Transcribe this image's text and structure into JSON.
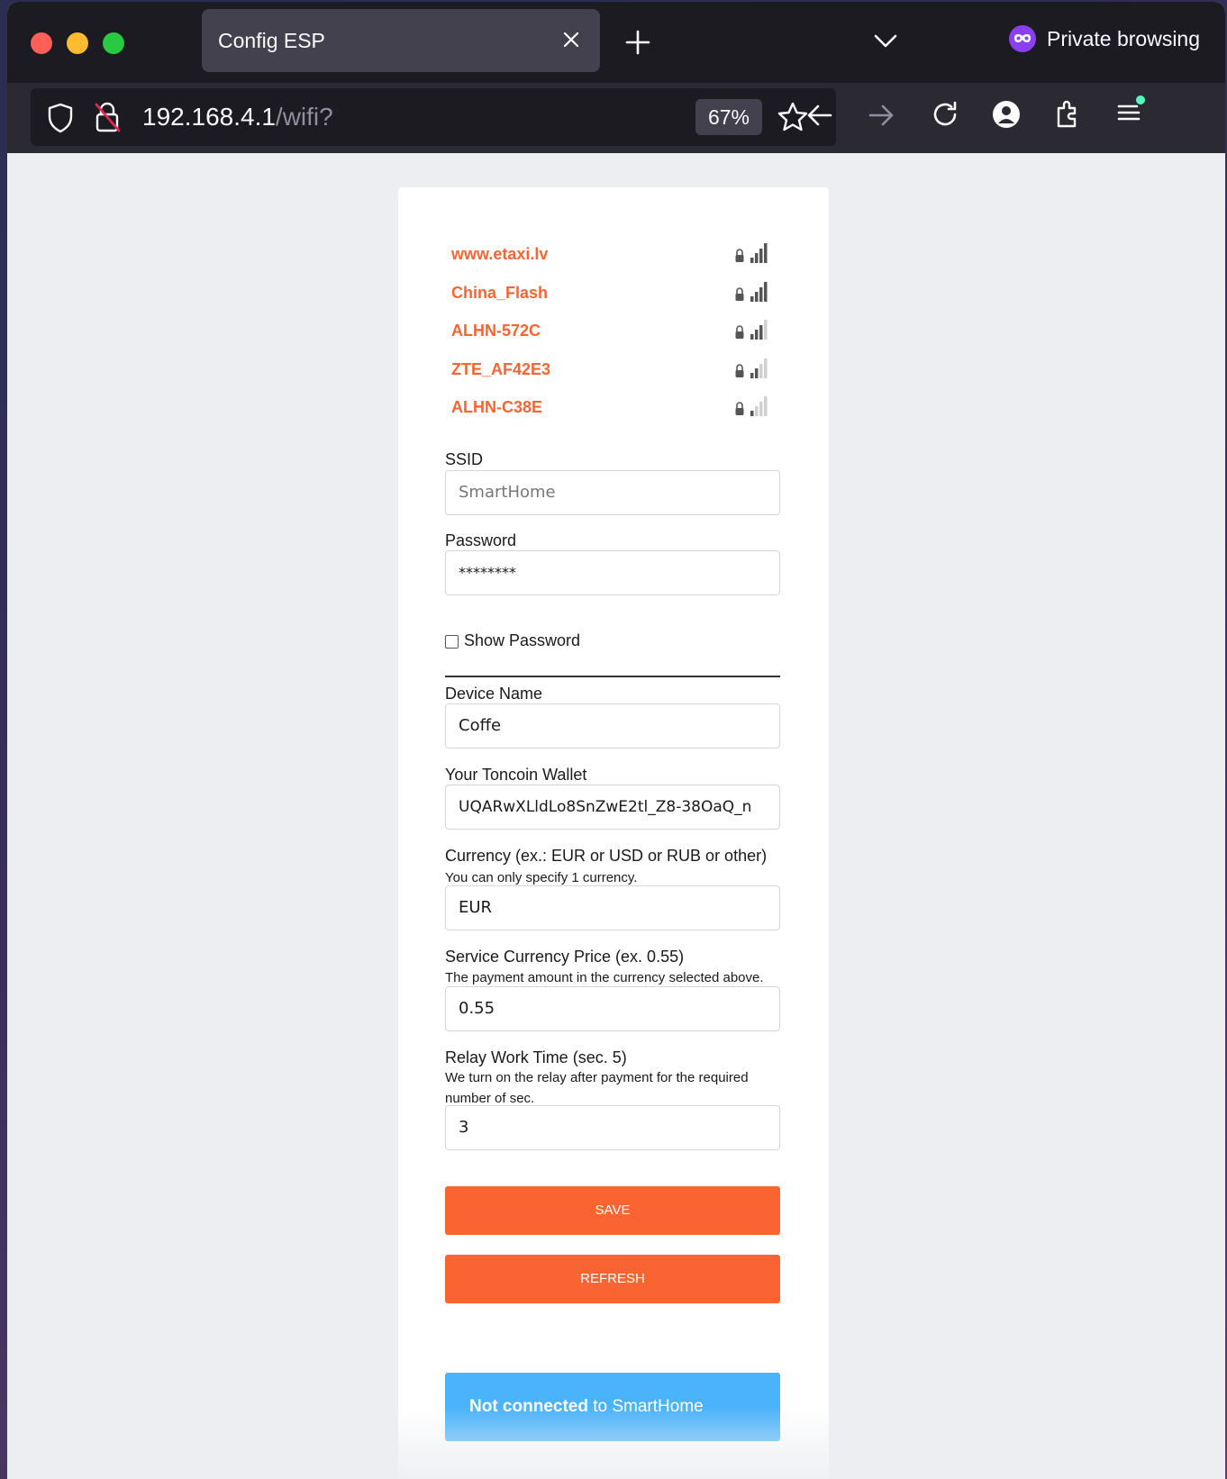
{
  "browser": {
    "tab_title": "Config ESP",
    "private_label": "Private browsing",
    "url_host": "192.168.4.1",
    "url_path": "/wifi?",
    "zoom": "67%"
  },
  "networks": [
    {
      "ssid": "www.etaxi.lv",
      "signal_bars": 4,
      "locked": true
    },
    {
      "ssid": "China_Flash",
      "signal_bars": 4,
      "locked": true
    },
    {
      "ssid": "ALHN-572C",
      "signal_bars": 3,
      "locked": true
    },
    {
      "ssid": "ZTE_AF42E3",
      "signal_bars": 2,
      "locked": true
    },
    {
      "ssid": "ALHN-C38E",
      "signal_bars": 1,
      "locked": true
    }
  ],
  "form": {
    "ssid_label": "SSID",
    "ssid_placeholder": "SmartHome",
    "password_label": "Password",
    "password_value": "********",
    "show_password_label": "Show Password",
    "device_name_label": "Device Name",
    "device_name_value": "Coffe",
    "wallet_label": "Your Toncoin Wallet",
    "wallet_value": "UQARwXLldLo8SnZwE2tl_Z8-38OaQ_n",
    "currency_label": "Currency (ex.: EUR or USD or RUB or other)",
    "currency_hint": "You can only specify 1 currency.",
    "currency_value": "EUR",
    "price_label": "Service Currency Price (ex. 0.55)",
    "price_hint": "The payment amount in the currency selected above.",
    "price_value": "0.55",
    "relay_label": "Relay Work Time (sec. 5)",
    "relay_hint": "We turn on the relay after payment for the required number of sec.",
    "relay_value": "3",
    "save_label": "SAVE",
    "refresh_label": "REFRESH"
  },
  "status": {
    "bold": "Not connected",
    "rest": " to SmartHome"
  },
  "colors": {
    "accent": "#fa6432",
    "status_bg": "#4ab3fc",
    "chrome_dark": "#1c1b22"
  }
}
